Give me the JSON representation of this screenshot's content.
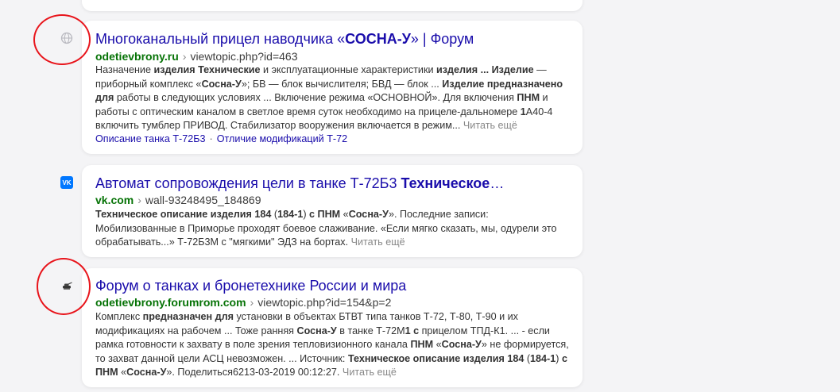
{
  "results": [
    {
      "title_parts": [
        {
          "t": "Многоканальный прицел наводчика «",
          "b": false
        },
        {
          "t": "СОСНА-У",
          "b": true
        },
        {
          "t": "» | Форум",
          "b": false
        }
      ],
      "domain": "odetievbrony.ru",
      "path": "viewtopic.php?id=463",
      "snippet_parts": [
        {
          "t": "Назначение ",
          "b": false
        },
        {
          "t": "изделия Технические",
          "b": true
        },
        {
          "t": " и эксплуатационные характеристики ",
          "b": false
        },
        {
          "t": "изделия ... Изделие",
          "b": true
        },
        {
          "t": " — приборный комплекс «",
          "b": false
        },
        {
          "t": "Сосна-У",
          "b": true
        },
        {
          "t": "»; БВ — блок вычислителя; БВД — блок ... ",
          "b": false
        },
        {
          "t": "Изделие предназначено для",
          "b": true
        },
        {
          "t": " работы в следующих условиях ... Включение режима «ОСНОВНОЙ». Для включения ",
          "b": false
        },
        {
          "t": "ПНМ",
          "b": true
        },
        {
          "t": " и работы с оптическим каналом в светлое время суток необходимо на прицеле-дальномере ",
          "b": false
        },
        {
          "t": "1",
          "b": true
        },
        {
          "t": "А40-4 включить тумблер ПРИВОД. Стабилизатор вооружения включается в режим...",
          "b": false
        }
      ],
      "more": "Читать ещё",
      "sitelinks": [
        "Описание танка Т-72Б3",
        "Отличие модификаций Т-72"
      ],
      "icon": "globe-icon"
    },
    {
      "title_parts": [
        {
          "t": "Автомат сопровождения цели в танке Т-72Б3 ",
          "b": false
        },
        {
          "t": "Техническое",
          "b": true
        },
        {
          "t": "…",
          "b": false
        }
      ],
      "domain": "vk.com",
      "path": "wall-93248495_184869",
      "snippet_parts": [
        {
          "t": "Техническое описание изделия 184",
          "b": true
        },
        {
          "t": " (",
          "b": false
        },
        {
          "t": "184-1",
          "b": true
        },
        {
          "t": ") ",
          "b": false
        },
        {
          "t": "с ПНМ",
          "b": true
        },
        {
          "t": " «",
          "b": false
        },
        {
          "t": "Сосна-У",
          "b": true
        },
        {
          "t": "». Последние записи: Мобилизованные в Приморье проходят боевое слаживание. «Если мягко сказать, мы, одурели это обрабатывать...» Т-72Б3М с \"мягкими\" ЭДЗ на бортах.",
          "b": false
        }
      ],
      "more": "Читать ещё",
      "icon": "vk-icon",
      "icon_text": "VK",
      "icon_color": "#0077ff"
    },
    {
      "title_parts": [
        {
          "t": "Форум о танках и бронетехнике России и мира",
          "b": false
        }
      ],
      "domain": "odetievbrony.forumrom.com",
      "path": "viewtopic.php?id=154&p=2",
      "snippet_parts": [
        {
          "t": "Комплекс ",
          "b": false
        },
        {
          "t": "предназначен для",
          "b": true
        },
        {
          "t": " установки в объектах БТВТ типа танков Т-72, Т-80, Т-90 и их модификациях на рабочем ... Тоже ранняя ",
          "b": false
        },
        {
          "t": "Сосна-У",
          "b": true
        },
        {
          "t": " в танке Т-72М",
          "b": false
        },
        {
          "t": "1 с",
          "b": true
        },
        {
          "t": " прицелом ТПД-К1. ... - если рамка готовности к захвату в поле зрения тепловизионного канала ",
          "b": false
        },
        {
          "t": "ПНМ",
          "b": true
        },
        {
          "t": " «",
          "b": false
        },
        {
          "t": "Сосна-У",
          "b": true
        },
        {
          "t": "» не формируется, то захват данной цели АСЦ невозможен. ... Источник: ",
          "b": false
        },
        {
          "t": "Техническое описание изделия 184",
          "b": true
        },
        {
          "t": " (",
          "b": false
        },
        {
          "t": "184-1",
          "b": true
        },
        {
          "t": ") ",
          "b": false
        },
        {
          "t": "с ПНМ",
          "b": true
        },
        {
          "t": " «",
          "b": false
        },
        {
          "t": "Сосна-У",
          "b": true
        },
        {
          "t": "». Поделиться6213-03-2019 00:12:27.",
          "b": false
        }
      ],
      "more": "Читать ещё",
      "icon": "tank-icon"
    }
  ],
  "annotation_color": "#e8141b"
}
